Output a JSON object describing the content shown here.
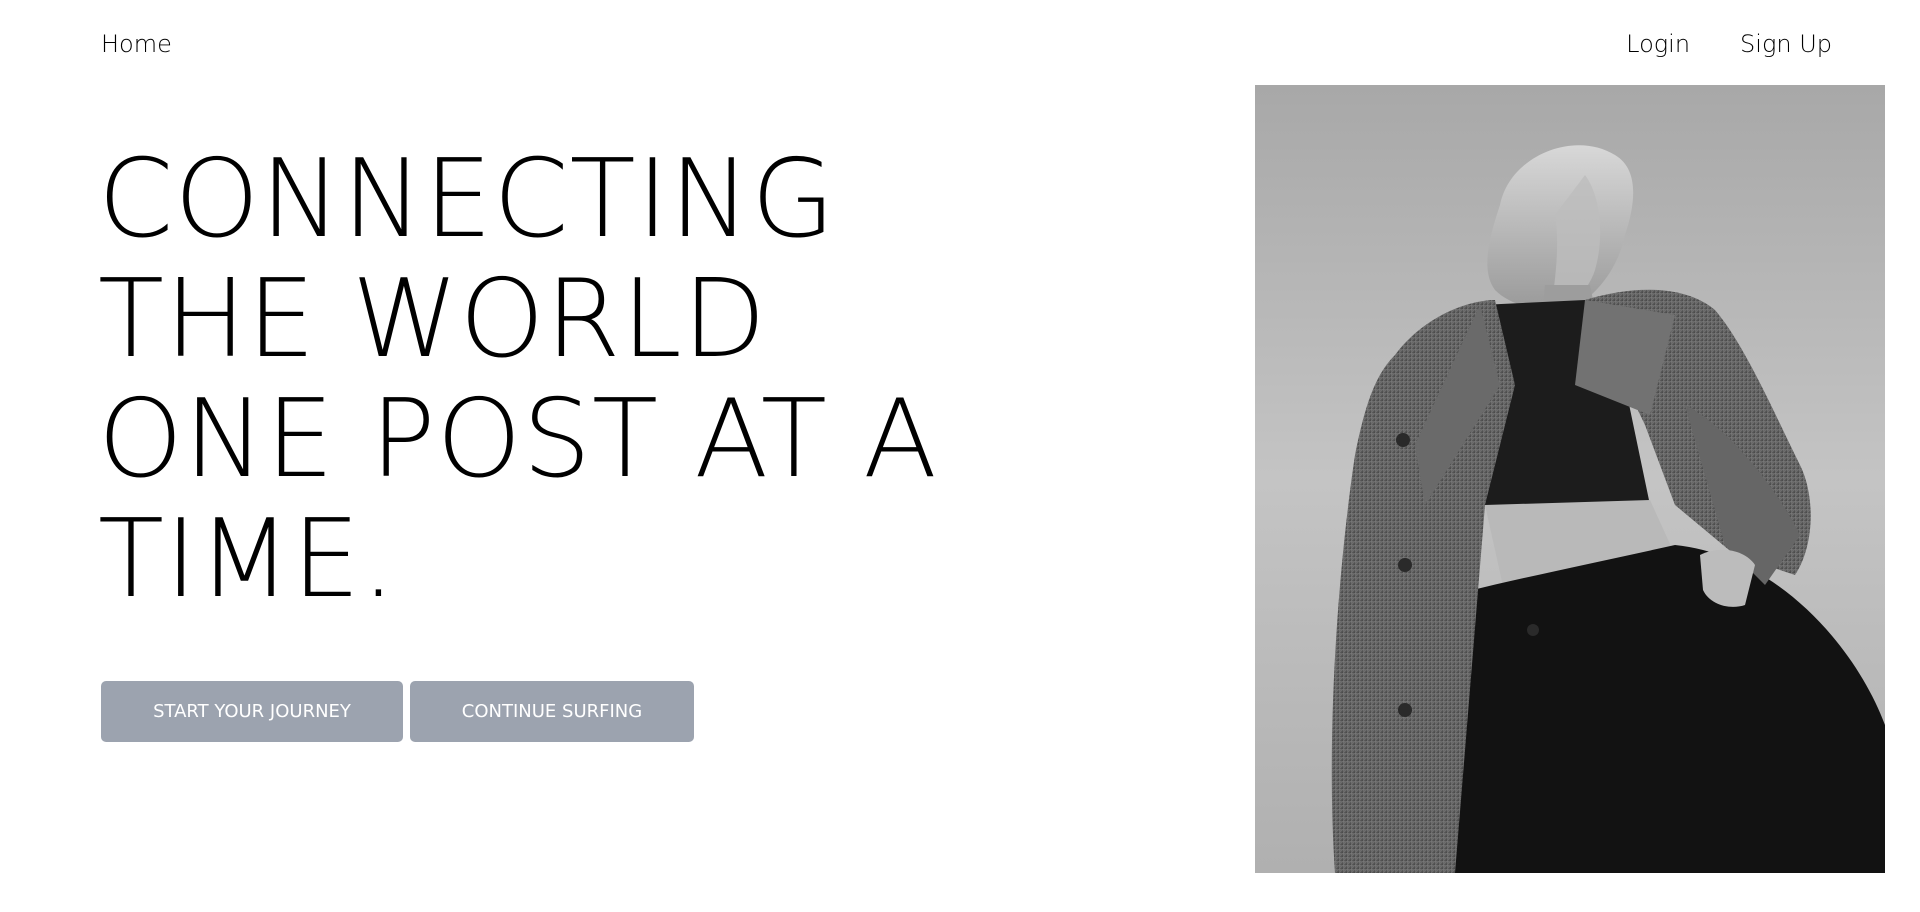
{
  "nav": {
    "home": "Home",
    "login": "Login",
    "signup": "Sign Up"
  },
  "hero": {
    "lines": [
      "CONNECTING",
      "THE WORLD",
      "ONE POST AT A",
      "TIME."
    ]
  },
  "buttons": {
    "start": "START YOUR JOURNEY",
    "continue": "CONTINUE SURFING"
  },
  "colors": {
    "button_bg": "#9ca3af",
    "button_text": "#ffffff",
    "text": "#000000",
    "background": "#ffffff"
  },
  "image": {
    "subject": "black-and-white fashion photo of a person in a tweed blazer and black trousers"
  }
}
